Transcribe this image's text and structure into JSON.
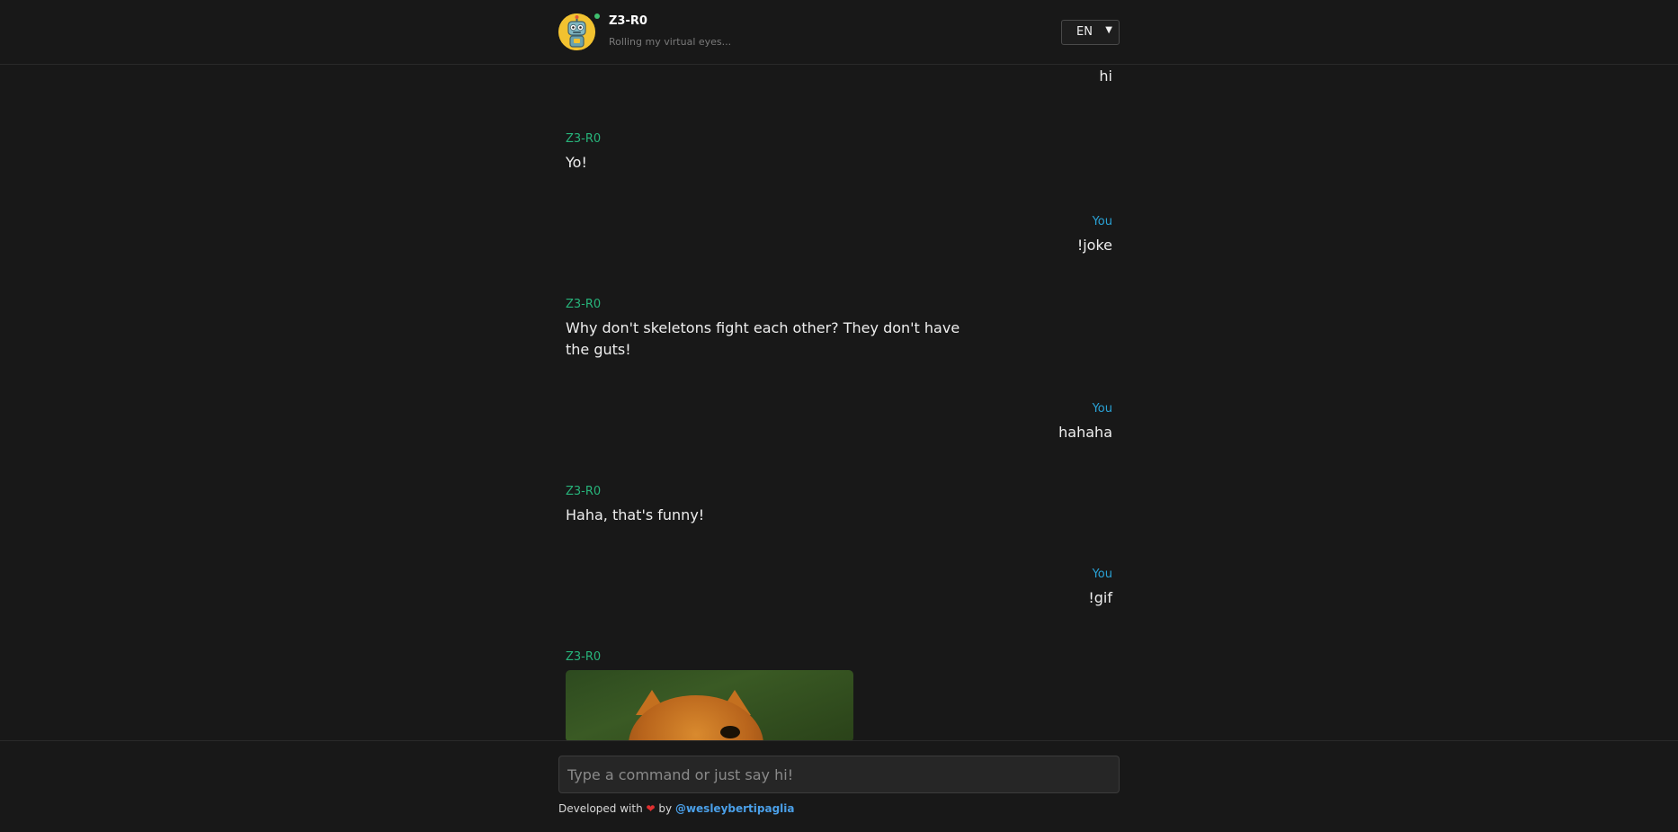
{
  "header": {
    "bot_name": "Z3-R0",
    "status": "Rolling my virtual eyes...",
    "language": "EN"
  },
  "messages": [
    {
      "sender": "",
      "text": "hi",
      "from": "user"
    },
    {
      "sender": "Z3-R0",
      "text": "Yo!",
      "from": "bot"
    },
    {
      "sender": "You",
      "text": "!joke",
      "from": "user"
    },
    {
      "sender": "Z3-R0",
      "text": "Why don't skeletons fight each other? They don't have the guts!",
      "from": "bot"
    },
    {
      "sender": "You",
      "text": "hahaha",
      "from": "user"
    },
    {
      "sender": "Z3-R0",
      "text": "Haha, that's funny!",
      "from": "bot"
    },
    {
      "sender": "You",
      "text": "!gif",
      "from": "user"
    },
    {
      "sender": "Z3-R0",
      "text": "",
      "from": "bot",
      "attachment": "gif"
    }
  ],
  "composer": {
    "placeholder": "Type a command or just say hi!"
  },
  "footer": {
    "prefix": "Developed with",
    "heart": "❤",
    "by": "by",
    "author": "@wesleybertipaglia"
  },
  "colors": {
    "background": "#181818",
    "bot_name": "#27b37a",
    "user_name": "#2aa2d6",
    "link": "#4a9fe8",
    "online": "#3fc06f",
    "heart": "#e03030"
  }
}
